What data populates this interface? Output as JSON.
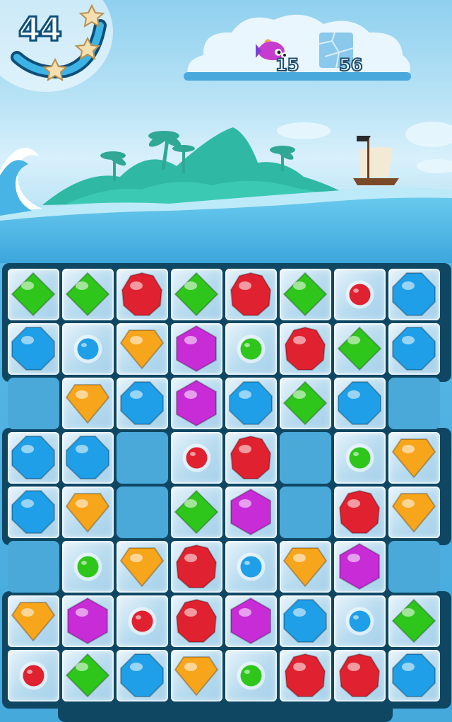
{
  "hud": {
    "moves_left": "44",
    "stars": [
      "star-icon",
      "star-icon",
      "star-icon"
    ],
    "goals": [
      {
        "icon": "pink-fish-icon",
        "count": "15"
      },
      {
        "icon": "ice-block-icon",
        "count": "56"
      }
    ]
  },
  "board": {
    "columns": 8,
    "rows": 8,
    "cells": [
      [
        "green-gem",
        "green-gem",
        "red-gem",
        "green-gem",
        "red-gem",
        "green-gem",
        "red-orb",
        "blue-gem"
      ],
      [
        "blue-gem",
        "blue-orb",
        "orange-gem",
        "purple-gem",
        "green-orb",
        "red-gem",
        "green-gem",
        "blue-gem"
      ],
      [
        null,
        "orange-gem",
        "blue-gem",
        "purple-gem",
        "blue-gem",
        "green-gem",
        "blue-gem",
        null
      ],
      [
        "blue-gem",
        "blue-gem",
        null,
        "red-orb",
        "red-gem",
        null,
        "green-orb",
        "orange-gem"
      ],
      [
        "blue-gem",
        "orange-gem",
        null,
        "green-gem",
        "purple-gem",
        null,
        "red-gem",
        "orange-gem"
      ],
      [
        null,
        "green-orb",
        "orange-gem",
        "red-gem",
        "blue-orb",
        "orange-gem",
        "purple-gem",
        null
      ],
      [
        "orange-gem",
        "purple-gem",
        "red-orb",
        "red-gem",
        "purple-gem",
        "blue-gem",
        "blue-orb",
        "green-gem"
      ],
      [
        "red-orb",
        "green-gem",
        "blue-gem",
        "orange-gem",
        "green-orb",
        "red-gem",
        "red-gem",
        "blue-gem"
      ]
    ]
  },
  "colors": {
    "red": "#e0212f",
    "green": "#2fc61c",
    "blue": "#1e9fe8",
    "orange": "#f7a51a",
    "purple": "#c72cd6",
    "frame": "#0f4763"
  }
}
